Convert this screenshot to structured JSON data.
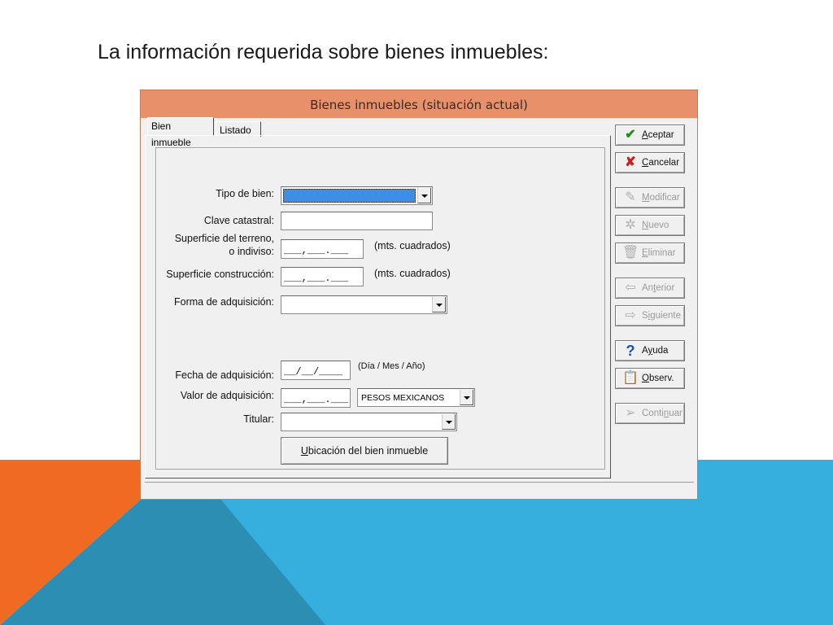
{
  "slide": {
    "title": "La información requerida sobre bienes inmuebles:",
    "colors": {
      "orange": "#f06a22",
      "blue": "#36afde",
      "dark_blue": "#2d8eb3",
      "teal": "#2c7fa0"
    }
  },
  "dialog": {
    "title": "Bienes inmuebles (situación actual)",
    "tabs": [
      {
        "label": "Bien inmueble",
        "active": true
      },
      {
        "label": "Listado",
        "active": false
      }
    ],
    "form": {
      "tipo_de_bien": {
        "label": "Tipo de bien:",
        "value": ""
      },
      "clave_catastral": {
        "label": "Clave catastral:",
        "value": ""
      },
      "superficie_terreno": {
        "label_line1": "Superficie del terreno,",
        "label_line2": "o indiviso:",
        "mask": "___,___.___",
        "unit": "(mts. cuadrados)"
      },
      "superficie_construccion": {
        "label": "Superficie construcción:",
        "mask": "___,___.___",
        "unit": "(mts. cuadrados)"
      },
      "forma_adquisicion": {
        "label": "Forma de adquisición:",
        "value": ""
      },
      "fecha_adquisicion": {
        "label": "Fecha de adquisición:",
        "mask": "__/__/____",
        "hint": "(Día / Mes / Año)"
      },
      "valor_adquisicion": {
        "label": "Valor de adquisición:",
        "mask": "___,___.___",
        "currency": "PESOS MEXICANOS"
      },
      "titular": {
        "label": "Titular:",
        "value": ""
      },
      "ubicacion_button": {
        "label_underlined": "U",
        "label_rest": "bicación del bien inmueble"
      }
    },
    "buttons": [
      {
        "key": "aceptar",
        "u": "A",
        "rest": "ceptar",
        "icon": "check-icon",
        "enabled": true
      },
      {
        "key": "cancelar",
        "u": "C",
        "rest": "ancelar",
        "icon": "x-icon",
        "enabled": true
      },
      {
        "key": "modificar",
        "u": "M",
        "rest": "odificar",
        "icon": "edit-icon",
        "enabled": false
      },
      {
        "key": "nuevo",
        "u": "N",
        "rest": "uevo",
        "icon": "new-icon",
        "enabled": false
      },
      {
        "key": "eliminar",
        "u": "E",
        "rest": "liminar",
        "icon": "trash-icon",
        "enabled": false
      },
      {
        "key": "anterior",
        "pre": "An",
        "u": "t",
        "rest": "erior",
        "icon": "arrow-left-icon",
        "enabled": false
      },
      {
        "key": "siguiente",
        "pre": "S",
        "u": "i",
        "rest": "guiente",
        "icon": "arrow-right-icon",
        "enabled": false
      },
      {
        "key": "ayuda",
        "pre": "A",
        "u": "y",
        "rest": "uda",
        "icon": "help-icon",
        "enabled": true
      },
      {
        "key": "observ",
        "u": "O",
        "rest": "bserv.",
        "icon": "notes-icon",
        "enabled": true
      },
      {
        "key": "continuar",
        "pre": "Conti",
        "u": "n",
        "rest": "uar",
        "icon": "continue-icon",
        "enabled": false
      }
    ]
  }
}
